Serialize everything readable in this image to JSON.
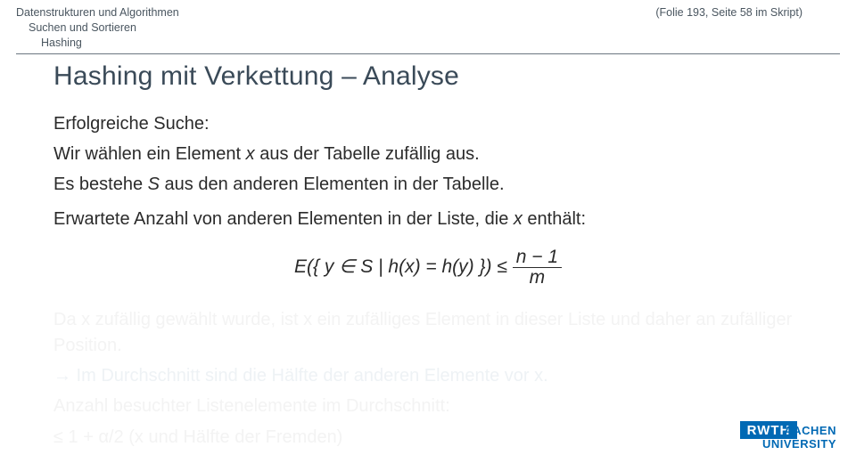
{
  "header": {
    "line1_left": "Datenstrukturen und Algorithmen",
    "line1_right": "(Folie 193, Seite 58 im Skript)",
    "line2": "Suchen und Sortieren",
    "line3": "Hashing"
  },
  "title": "Hashing mit Verkettung – Analyse",
  "content": {
    "p1a": "Erfolgreiche Suche:",
    "p1b_pre": "Wir wählen ein Element ",
    "p1b_x": "x",
    "p1b_post": " aus der Tabelle zufällig aus.",
    "p2_pre": "Es bestehe ",
    "p2_S": "S",
    "p2_post": " aus den anderen Elementen in der Tabelle.",
    "p3_pre": "Erwartete Anzahl von anderen Elementen in der Liste, die ",
    "p3_x": "x",
    "p3_post": " enthält:",
    "formula_left": "E({ y ∈ S | h(x) = h(y) }) ≤ ",
    "formula_num": "n − 1",
    "formula_den": "m",
    "f1": "Da x zufällig gewählt wurde, ist x ein zufälliges Element in dieser Liste und daher an zufälliger Position.",
    "f2": "→ Im Durchschnitt sind die Hälfte der anderen Elemente vor x.",
    "f3a": "Anzahl besuchter Listenelemente im Durchschnitt:",
    "f3b": "≤ 1 + α/2 (x und Hälfte der Fremden)"
  },
  "logo": {
    "line1": "RWTH",
    "line2": "AACHEN",
    "line3": "UNIVERSITY"
  }
}
